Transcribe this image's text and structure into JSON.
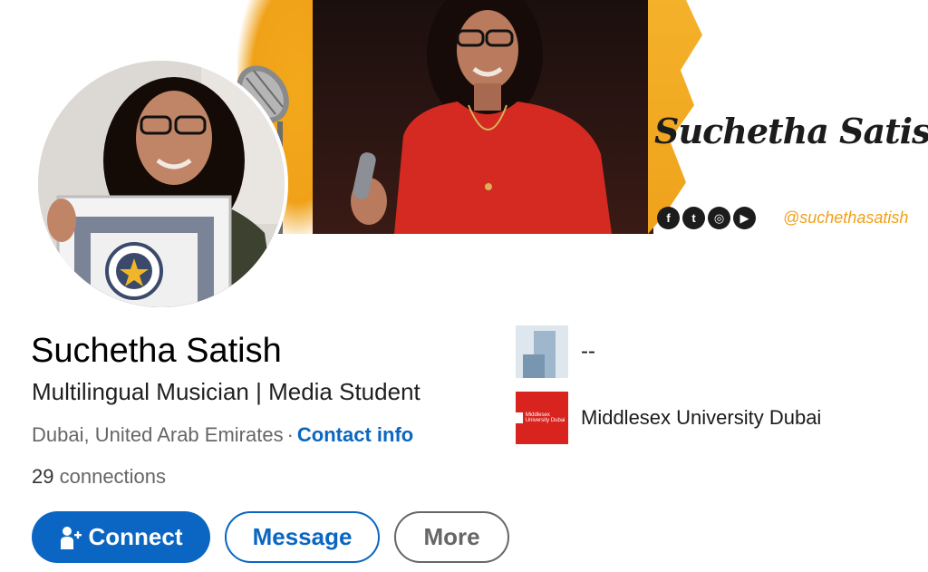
{
  "banner": {
    "name": "Suchetha Satish",
    "handle": "@suchethasatish",
    "social_icons": [
      "facebook-icon",
      "twitter-icon",
      "instagram-icon",
      "youtube-icon"
    ],
    "social_glyphs": [
      "f",
      "t",
      "◎",
      "▶"
    ]
  },
  "profile": {
    "name": "Suchetha Satish",
    "headline": "Multilingual Musician | Media Student",
    "location": "Dubai, United Arab Emirates",
    "separator": "·",
    "contact_info": "Contact info",
    "connections_count": "29",
    "connections_label": "connections"
  },
  "current_company": {
    "name": "--"
  },
  "education": {
    "name": "Middlesex University Dubai",
    "logo_text": "Middlesex University Dubai"
  },
  "actions": {
    "connect": "Connect",
    "message": "Message",
    "more": "More"
  },
  "colors": {
    "accent": "#0a66c2",
    "banner_orange": "#f0a01a",
    "mdx_red": "#d8231f"
  }
}
